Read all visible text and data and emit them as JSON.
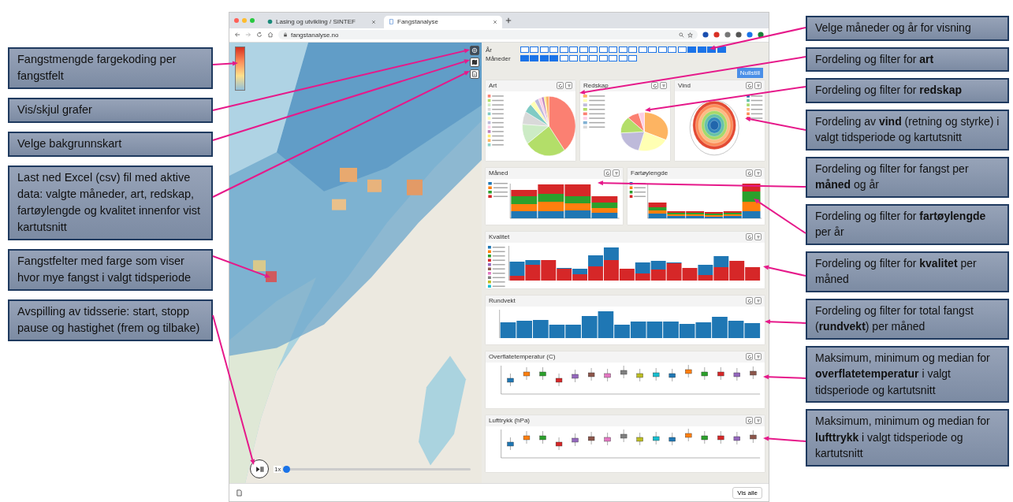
{
  "left_callouts": [
    {
      "text": "Fangstmengde fargekoding per fangstfelt"
    },
    {
      "text": "Vis/skjul grafer"
    },
    {
      "text": "Velge bakgrunnskart"
    },
    {
      "text": "Last ned Excel (csv) fil med aktive data: valgte måneder, art, redskap, fartøylengde og kvalitet innenfor vist kartutsnitt"
    },
    {
      "text": "Fangstfelter med farge som viser hvor mye fangst i valgt tidsperiode"
    },
    {
      "text": "Avspilling av tidsserie: start, stopp pause og hastighet (frem og tilbake)"
    }
  ],
  "right_callouts": [
    {
      "text": "Velge måneder og år for visning"
    },
    {
      "text": "Fordeling og filter for **art**"
    },
    {
      "text": "Fordeling og filter for **redskap**"
    },
    {
      "text": "Fordeling av **vind**  (retning og styrke) i valgt tidsperiode og kartutsnitt"
    },
    {
      "text": "Fordeling og filter for fangst per **måned** og år"
    },
    {
      "text": "Fordeling og filter for **fartøylengde** per år"
    },
    {
      "text": "Fordeling og filter for **kvalitet** per måned"
    },
    {
      "text": "Fordeling og filter for total fangst (**rundvekt**) per måned"
    },
    {
      "text": "Maksimum, minimum og median for **overflatetemperatur** i valgt tidsperiode og kartutsnitt"
    },
    {
      "text": "Maksimum, minimum og median for **lufttrykk** i valgt tidsperiode og kartutsnitt"
    }
  ],
  "browser": {
    "tabs": [
      {
        "label": "Lasing og utvikling / SINTEF",
        "selected": false
      },
      {
        "label": "Fangstanalyse",
        "selected": true
      }
    ],
    "url": "fangstanalyse.no"
  },
  "map": {
    "playback": {
      "speed": "1x",
      "level": 0
    }
  },
  "filters": {
    "year_label": "År",
    "month_label": "Måneder",
    "reset_button": "Nullstill",
    "years": [
      {
        "selected": false
      },
      {
        "selected": false
      },
      {
        "selected": false
      },
      {
        "selected": false
      },
      {
        "selected": false
      },
      {
        "selected": false
      },
      {
        "selected": false
      },
      {
        "selected": false
      },
      {
        "selected": false
      },
      {
        "selected": false
      },
      {
        "selected": false
      },
      {
        "selected": false
      },
      {
        "selected": false
      },
      {
        "selected": false
      },
      {
        "selected": false
      },
      {
        "selected": false
      },
      {
        "selected": false
      },
      {
        "selected": true
      },
      {
        "selected": true
      },
      {
        "selected": true
      },
      {
        "selected": true
      }
    ],
    "months": [
      {
        "selected": true
      },
      {
        "selected": true
      },
      {
        "selected": true
      },
      {
        "selected": true
      },
      {
        "selected": false
      },
      {
        "selected": false
      },
      {
        "selected": false
      },
      {
        "selected": false
      },
      {
        "selected": false
      },
      {
        "selected": false
      },
      {
        "selected": false
      },
      {
        "selected": false
      }
    ]
  },
  "panel_rows": [
    {
      "panels": [
        {
          "title": "Art",
          "kind": "pie"
        },
        {
          "title": "Redskap",
          "kind": "pie-small"
        },
        {
          "title": "Vind",
          "kind": "rose"
        }
      ]
    },
    {
      "panels": [
        {
          "title": "Måned",
          "kind": "stacked-bar"
        },
        {
          "title": "Fartøylengde",
          "kind": "stacked-bar-wide"
        }
      ]
    },
    {
      "panels": [
        {
          "title": "Kvalitet",
          "kind": "quality-bar"
        }
      ]
    },
    {
      "panels": [
        {
          "title": "Rundvekt",
          "kind": "bar"
        }
      ]
    },
    {
      "panels": [
        {
          "title": "Overflatetemperatur (C)",
          "kind": "boxplot"
        }
      ]
    },
    {
      "panels": [
        {
          "title": "Lufttrykk (hPa)",
          "kind": "boxplot"
        }
      ]
    }
  ],
  "download_bar": {
    "button": "Vis alle"
  }
}
